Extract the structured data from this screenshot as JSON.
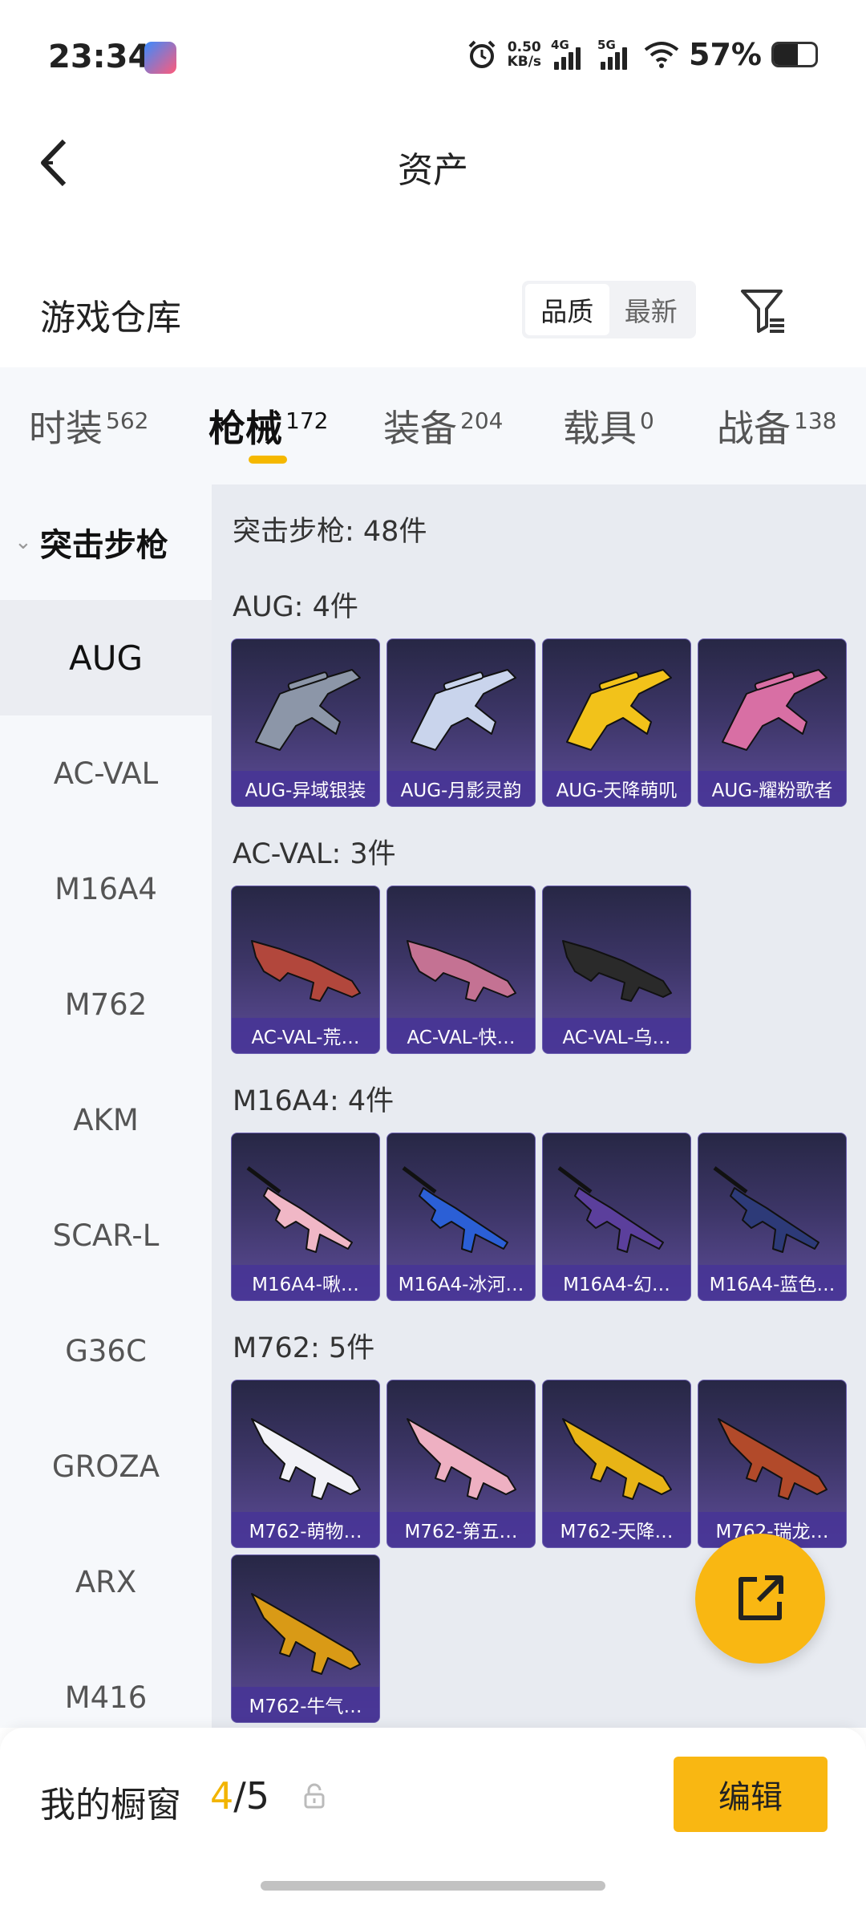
{
  "status_bar": {
    "time": "23:34",
    "net_speed_value": "0.50",
    "net_speed_unit": "KB/s",
    "sim1": "4G",
    "sim2": "5G",
    "battery_pct": "57%",
    "battery_level": 0.57
  },
  "header": {
    "title": "资产"
  },
  "warehouse": {
    "title": "游戏仓库",
    "sort_options": [
      "品质",
      "最新"
    ],
    "selected_sort": "品质"
  },
  "tabs": [
    {
      "label": "时装",
      "count": "562"
    },
    {
      "label": "枪械",
      "count": "172",
      "active": true
    },
    {
      "label": "装备",
      "count": "204"
    },
    {
      "label": "载具",
      "count": "0"
    },
    {
      "label": "战备",
      "count": "138"
    }
  ],
  "sidebar": {
    "group": "突击步枪",
    "items": [
      "AUG",
      "AC-VAL",
      "M16A4",
      "M762",
      "AKM",
      "SCAR-L",
      "G36C",
      "GROZA",
      "ARX",
      "M416"
    ],
    "active": "AUG"
  },
  "content": {
    "total": "突击步枪: 48件",
    "groups": [
      {
        "label": "AUG: 4件",
        "items": [
          "AUG-异域银装",
          "AUG-月影灵韵",
          "AUG-天降萌叽",
          "AUG-耀粉歌者"
        ]
      },
      {
        "label": "AC-VAL: 3件",
        "items": [
          "AC-VAL-荒…",
          "AC-VAL-快…",
          "AC-VAL-乌…"
        ]
      },
      {
        "label": "M16A4: 4件",
        "items": [
          "M16A4-啾…",
          "M16A4-冰河…",
          "M16A4-幻…",
          "M16A4-蓝色…"
        ]
      },
      {
        "label": "M762: 5件",
        "items": [
          "M762-萌物…",
          "M762-第五…",
          "M762-天降…",
          "M762-瑞龙…",
          "M762-牛气…"
        ]
      }
    ]
  },
  "colors": {
    "accent": "#f9b712",
    "card_gradient_top": "#272745",
    "card_gradient_bottom": "#5d4c98",
    "skin_colors": {
      "AUG": [
        "#8c96a8",
        "#c9d4ec",
        "#f2c21a",
        "#d86fa4"
      ],
      "AC-VAL": [
        "#b2473c",
        "#c47293",
        "#2a2a2a"
      ],
      "M16A4": [
        "#f0b7c6",
        "#2b5fd6",
        "#5b3f9c",
        "#2d3a78"
      ],
      "M762": [
        "#f2f2f7",
        "#eeb0c2",
        "#e8b416",
        "#b24a2a",
        "#d99a16"
      ]
    }
  },
  "bottom_bar": {
    "label": "我的橱窗",
    "current": "4",
    "separator": "/",
    "total": "5",
    "edit_label": "编辑"
  }
}
